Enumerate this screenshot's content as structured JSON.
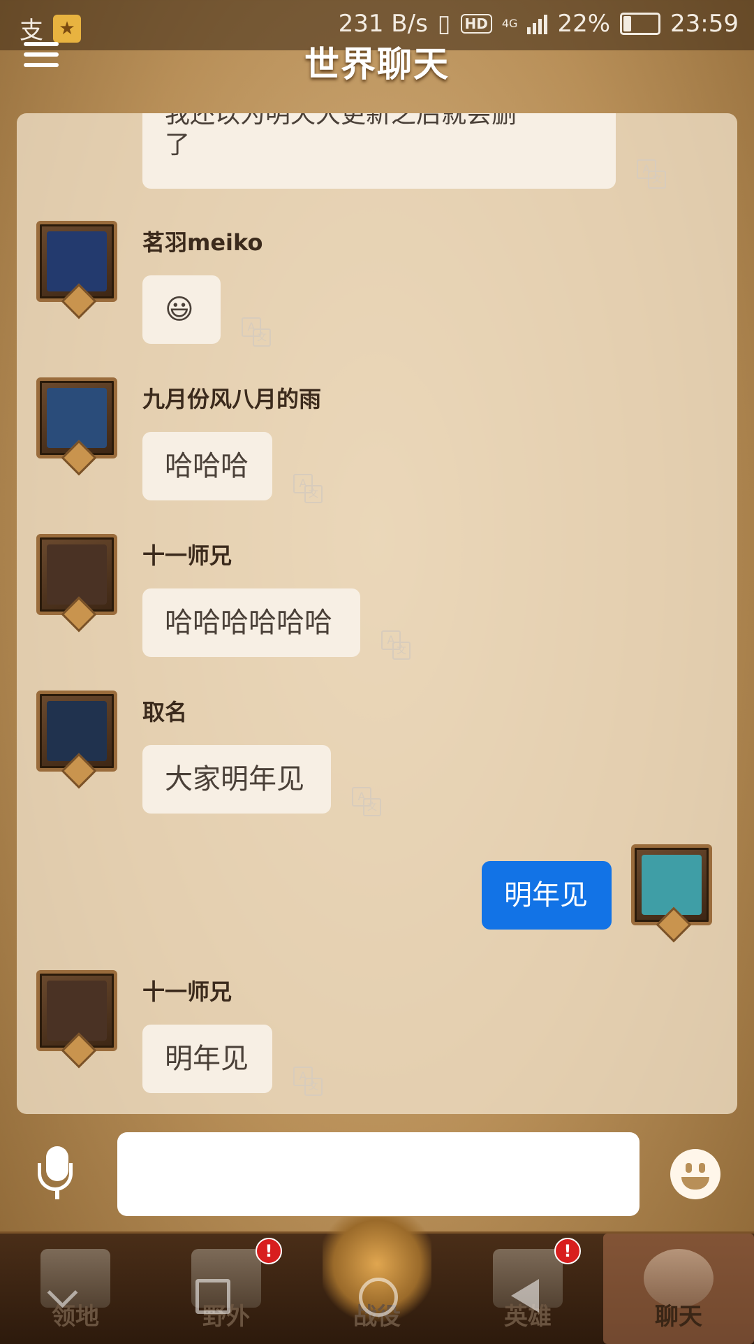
{
  "status_bar": {
    "left_icons": [
      "支",
      "★"
    ],
    "network_speed": "231 B/s",
    "hd_label": "HD",
    "network_type": "4G",
    "battery_percent": "22%",
    "time": "23:59"
  },
  "header": {
    "title": "世界聊天"
  },
  "messages": [
    {
      "type": "partial",
      "text_line1": "我还以为明天大更新之后就会删",
      "text_line2": "了"
    },
    {
      "type": "other",
      "username": "茗羽meiko",
      "text": "😃",
      "avatar_color": "#233a6e"
    },
    {
      "type": "other",
      "username": "九月份风八月的雨",
      "text": "哈哈哈",
      "avatar_color": "#2a4c7a"
    },
    {
      "type": "other",
      "username": "十一师兄",
      "text": "哈哈哈哈哈哈",
      "avatar_color": "#4a3224"
    },
    {
      "type": "other",
      "username": "取名",
      "text": "大家明年见",
      "avatar_color": "#20324e"
    },
    {
      "type": "self",
      "text": "明年见",
      "avatar_color": "#3f9ea6"
    },
    {
      "type": "other",
      "username": "十一师兄",
      "text": "明年见",
      "avatar_color": "#4a3224"
    }
  ],
  "translate_icon": {
    "a": "A",
    "b": "文"
  },
  "input": {
    "placeholder": ""
  },
  "bottom_nav": {
    "tabs": [
      {
        "label": "领地",
        "badge": ""
      },
      {
        "label": "野外",
        "badge": "!"
      },
      {
        "label": "战役",
        "badge": ""
      },
      {
        "label": "英雄",
        "badge": "!"
      },
      {
        "label": "聊天",
        "badge": ""
      }
    ],
    "active_tab": "聊天"
  },
  "colors": {
    "self_bubble": "#1273e6",
    "other_bubble": "#f7efe4",
    "panel": "#f0e0c8",
    "badge": "#d81e1e"
  }
}
